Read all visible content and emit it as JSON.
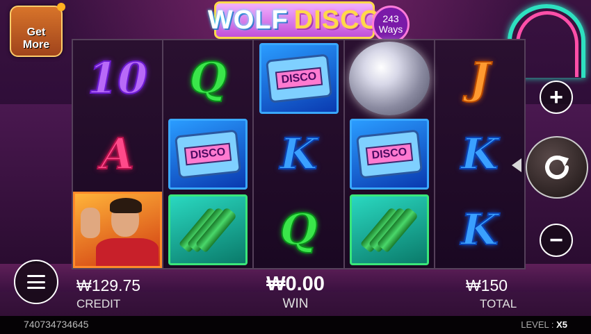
{
  "title": {
    "word1": "WOLF",
    "word2": "DISCO",
    "ways_number": "243",
    "ways_word": "Ways"
  },
  "get_more": {
    "line1": "Get",
    "line2": "More"
  },
  "reels": [
    [
      "10",
      "A",
      "hero"
    ],
    [
      "Q",
      "pager",
      "bottles"
    ],
    [
      "pager",
      "K",
      "Q"
    ],
    [
      "disco-ball",
      "pager",
      "bottles"
    ],
    [
      "J",
      "K",
      "K"
    ]
  ],
  "pager_screen_text": "DISCO",
  "controls": {
    "plus": "+",
    "minus": "−"
  },
  "credit": {
    "value": "₩129.75",
    "label": "CREDIT"
  },
  "win": {
    "value": "₩0.00",
    "label": "WIN"
  },
  "total": {
    "value": "₩150",
    "label": "TOTAL"
  },
  "footer": {
    "serial": "740734734645",
    "level_label": "LEVEL :",
    "level_value": "X5"
  }
}
